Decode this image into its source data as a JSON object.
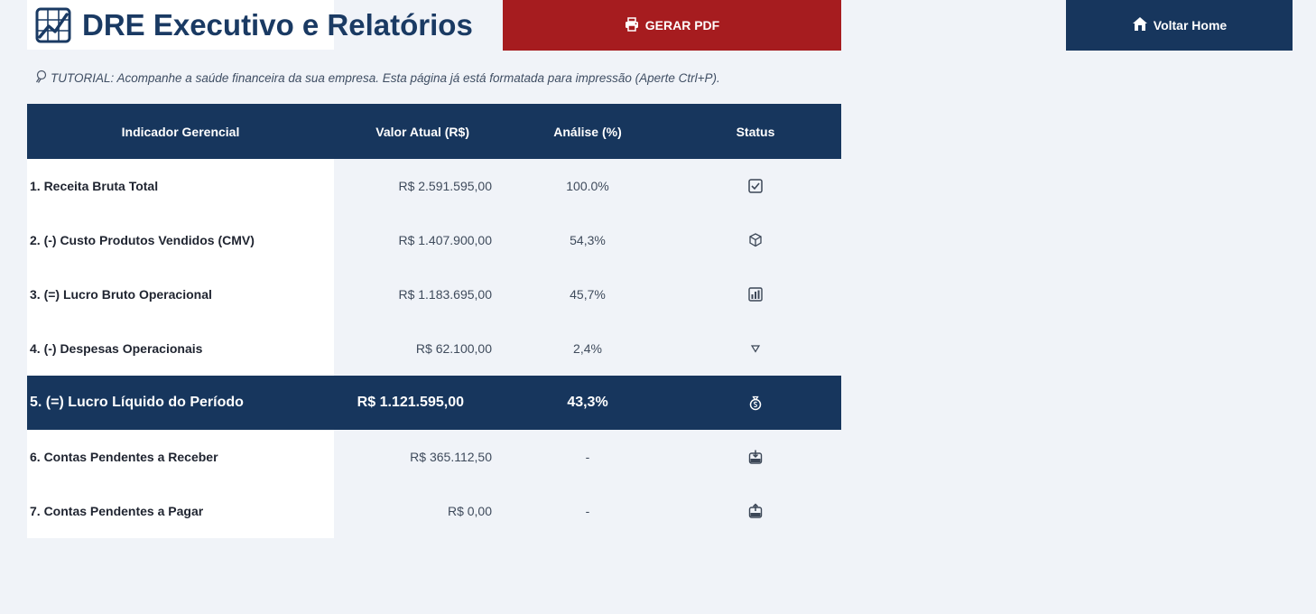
{
  "header": {
    "title": "DRE Executivo e Relatórios",
    "pdf_button": "GERAR PDF",
    "home_button": "Voltar Home",
    "title_icon": "chart-line-icon"
  },
  "tutorial": "TUTORIAL: Acompanhe a saúde financeira da sua empresa. Esta página já está formatada para impressão (Aperte Ctrl+P).",
  "table": {
    "columns": [
      "Indicador Gerencial",
      "Valor Atual (R$)",
      "Análise (%)",
      "Status"
    ],
    "rows": [
      {
        "indicator": "1. Receita Bruta Total",
        "value": "R$ 2.591.595,00",
        "pct": "100.0%",
        "status_icon": "checkbox-icon"
      },
      {
        "indicator": "2. (-) Custo Produtos Vendidos (CMV)",
        "value": "R$ 1.407.900,00",
        "pct": "54,3%",
        "status_icon": "package-icon"
      },
      {
        "indicator": "3. (=) Lucro Bruto Operacional",
        "value": "R$ 1.183.695,00",
        "pct": "45,7%",
        "status_icon": "bar-chart-icon"
      },
      {
        "indicator": "4. (-) Despesas Operacionais",
        "value": "R$ 62.100,00",
        "pct": "2,4%",
        "status_icon": "triangle-down-icon"
      },
      {
        "indicator": "5. (=) Lucro Líquido do Período",
        "value": "R$ 1.121.595,00",
        "pct": "43,3%",
        "status_icon": "money-bag-icon"
      },
      {
        "indicator": "6. Contas Pendentes a Receber",
        "value": "R$ 365.112,50",
        "pct": "-",
        "status_icon": "inbox-in-icon"
      },
      {
        "indicator": "7. Contas Pendentes a Pagar",
        "value": "R$ 0,00",
        "pct": "-",
        "status_icon": "outbox-icon"
      }
    ]
  },
  "colors": {
    "primary": "#17365d",
    "danger": "#a61c1f",
    "background": "#f0f3f8"
  }
}
